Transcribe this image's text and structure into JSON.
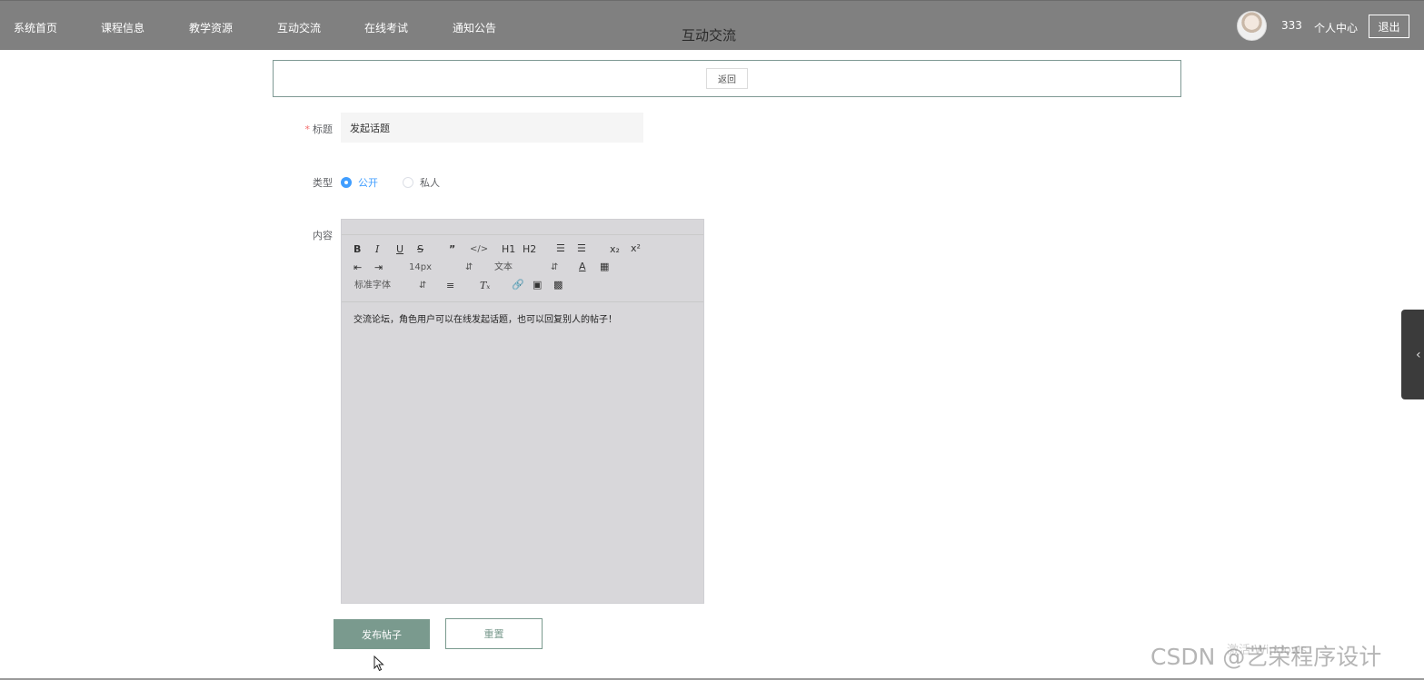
{
  "nav": {
    "items": [
      "系统首页",
      "课程信息",
      "教学资源",
      "互动交流",
      "在线考试",
      "通知公告"
    ],
    "page_title": "互动交流",
    "username": "333",
    "user_center": "个人中心",
    "logout": "退出"
  },
  "back": {
    "label": "返回"
  },
  "form": {
    "title_label": "标题",
    "required_mark": "*",
    "title_value": "发起话题",
    "type_label": "类型",
    "type_options": [
      {
        "label": "公开",
        "selected": true
      },
      {
        "label": "私人",
        "selected": false
      }
    ],
    "content_label": "内容",
    "content_text": "交流论坛，角色用户可以在线发起话题，也可以回复别人的帖子！"
  },
  "editor_toolbar": {
    "font_size": "14px",
    "text_style": "文本",
    "font_family": "标准字体",
    "h1": "H1",
    "h2": "H2"
  },
  "buttons": {
    "publish": "发布帖子",
    "reset": "重置"
  },
  "watermark": {
    "brand": "CSDN @艺荣程序设计",
    "windows_notice": "激活 Windows"
  },
  "colors": {
    "topbar": "#808080",
    "accent": "#7a9a8e",
    "radio_active": "#409eff",
    "required": "#f56c6c",
    "editor_bg": "#d8d7da"
  }
}
